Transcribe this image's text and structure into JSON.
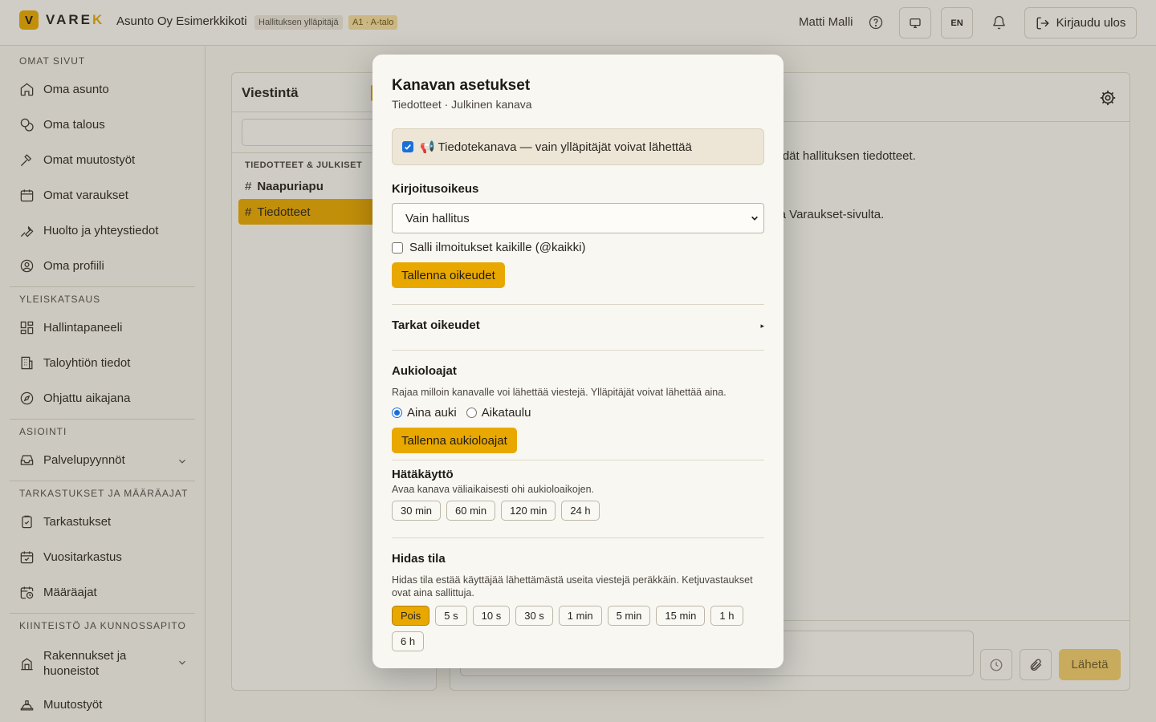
{
  "header": {
    "logo_letter": "V",
    "logo_text_main": "VARE",
    "logo_text_accent": "K",
    "org_name": "Asunto Oy Esimerkkikoti",
    "role_badge": "Hallituksen ylläpitäjä",
    "apartment_badge": "A1 · A-talo",
    "user_name": "Matti Malli",
    "language": "EN",
    "logout_label": "Kirjaudu ulos"
  },
  "sidebar": {
    "sections": [
      {
        "title": "OMAT SIVUT",
        "items": [
          {
            "label": "Oma asunto",
            "icon": "home-icon"
          },
          {
            "label": "Oma talous",
            "icon": "coins-icon"
          },
          {
            "label": "Omat muutostyöt",
            "icon": "hammer-icon"
          },
          {
            "label": "Omat varaukset",
            "icon": "calendar-icon"
          },
          {
            "label": "Huolto ja yhteystiedot",
            "icon": "wrench-icon"
          },
          {
            "label": "Oma profiili",
            "icon": "user-circle-icon"
          }
        ]
      },
      {
        "title": "YLEISKATSAUS",
        "items": [
          {
            "label": "Hallintapaneeli",
            "icon": "dashboard-icon"
          },
          {
            "label": "Taloyhtiön tiedot",
            "icon": "building-icon"
          },
          {
            "label": "Ohjattu aikajana",
            "icon": "compass-icon"
          }
        ]
      },
      {
        "title": "ASIOINTI",
        "items": [
          {
            "label": "Palvelupyynnöt",
            "icon": "inbox-icon"
          }
        ]
      },
      {
        "title": "TARKASTUKSET JA MÄÄRÄAJAT",
        "items": [
          {
            "label": "Tarkastukset",
            "icon": "clipboard-check-icon"
          },
          {
            "label": "Vuositarkastus",
            "icon": "calendar-check-icon"
          },
          {
            "label": "Määräajat",
            "icon": "calendar-clock-icon"
          }
        ]
      },
      {
        "title": "KIINTEISTÖ JA KUNNOSSAPITO",
        "items": [
          {
            "label_line1": "Rakennukset ja",
            "label_line2": "huoneistot",
            "icon": "building-columns-icon"
          },
          {
            "label": "Muutostyöt",
            "icon": "hardhat-icon"
          }
        ]
      }
    ]
  },
  "messaging": {
    "title": "Viestintä",
    "group_title": "TIEDOTTEET & JULKISET",
    "channels": [
      {
        "hash": "#",
        "name": "Naapuriapu"
      },
      {
        "hash": "#",
        "name": "Tiedotteet"
      }
    ]
  },
  "chat": {
    "line1": "öydät hallituksen tiedotteet.",
    "line2": "oja Varaukset-sivulta.",
    "send_label": "Lähetä"
  },
  "modal": {
    "title": "Kanavan asetukset",
    "subtitle": "Tiedotteet · Julkinen kanava",
    "announcement_label": "📢 Tiedotekanava — vain ylläpitäjät voivat lähettää",
    "announcement_checked": true,
    "write_permission_label": "Kirjoitusoikeus",
    "write_permission_value": "Vain hallitus",
    "allow_mentions_label": "Salli ilmoitukset kaikille (@kaikki)",
    "allow_mentions_checked": false,
    "save_permissions_label": "Tallenna oikeudet",
    "fine_permissions_label": "Tarkat oikeudet",
    "fine_permissions_marker": "▸",
    "opening_hours_title": "Aukioloajat",
    "opening_hours_desc": "Rajaa milloin kanavalle voi lähettää viestejä. Ylläpitäjät voivat lähettää aina.",
    "opening_options": [
      {
        "label": "Aina auki",
        "selected": true
      },
      {
        "label": "Aikataulu",
        "selected": false
      }
    ],
    "save_opening_label": "Tallenna aukioloajat",
    "emergency_title": "Hätäkäyttö",
    "emergency_desc": "Avaa kanava väliaikaisesti ohi aukioloaikojen.",
    "emergency_options": [
      "30 min",
      "60 min",
      "120 min",
      "24 h"
    ],
    "slowmode_title": "Hidas tila",
    "slowmode_desc": "Hidas tila estää käyttäjää lähettämästä useita viestejä peräkkäin. Ketjuvastaukset ovat aina sallittuja.",
    "slowmode_options": [
      "Pois",
      "5 s",
      "10 s",
      "30 s",
      "1 min",
      "5 min",
      "15 min",
      "1 h",
      "6 h"
    ],
    "slowmode_selected": "Pois"
  },
  "colors": {
    "accent": "#e8a800",
    "checkbox_blue": "#1a6fd8"
  }
}
